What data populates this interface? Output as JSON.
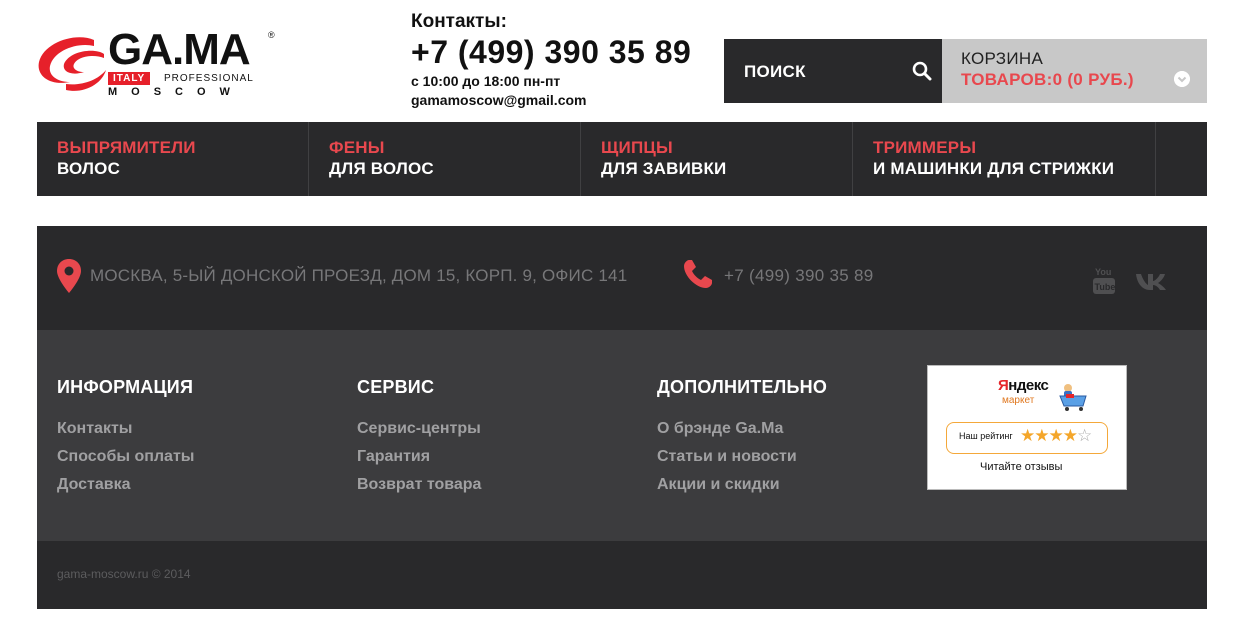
{
  "header": {
    "logo": {
      "word": "GA.MA",
      "reg": "®",
      "italy": "ITALY",
      "professional": "PROFESSIONAL",
      "moscow": "MOSCOW"
    },
    "contacts": {
      "title": "Контакты:",
      "phone": "+7 (499) 390 35 89",
      "hours": "с 10:00 до 18:00 пн-пт",
      "email": "gamamoscow@gmail.com"
    },
    "search": {
      "label": "ПОИСК"
    },
    "cart": {
      "title": "КОРЗИНА",
      "count": "ТОВАРОВ:0 (0 РУБ.)"
    }
  },
  "nav": {
    "items": [
      {
        "top": "ВЫПРЯМИТЕЛИ",
        "bottom": "ВОЛОС"
      },
      {
        "top": "ФЕНЫ",
        "bottom": "ДЛЯ ВОЛОС"
      },
      {
        "top": "ЩИПЦЫ",
        "bottom": "ДЛЯ ЗАВИВКИ"
      },
      {
        "top": "ТРИММЕРЫ",
        "bottom": "И МАШИНКИ ДЛЯ СТРИЖКИ"
      }
    ]
  },
  "strip": {
    "address": "МОСКВА, 5-ЫЙ ДОНСКОЙ ПРОЕЗД, ДОМ 15, КОРП. 9, ОФИС 141",
    "phone": "+7 (499) 390 35 89"
  },
  "footer": {
    "columns": [
      {
        "title": "ИНФОРМАЦИЯ",
        "links": [
          "Контакты",
          "Способы оплаты",
          "Доставка"
        ]
      },
      {
        "title": "СЕРВИС",
        "links": [
          "Сервис-центры",
          "Гарантия",
          "Возврат товара"
        ]
      },
      {
        "title": "ДОПОЛНИТЕЛЬНО",
        "links": [
          "О брэнде Ga.Ma",
          "Статьи и новости",
          "Акции и скидки"
        ]
      }
    ],
    "market": {
      "yandex_first": "Я",
      "yandex_rest": "ндекс",
      "sub": "маркет",
      "rating_label": "Наш рейтинг",
      "stars_filled": 4,
      "stars_total": 5,
      "reviews": "Читайте отзывы"
    }
  },
  "bottom": {
    "copyright": "gama-moscow.ru © 2014"
  },
  "colors": {
    "dark": "#29292b",
    "mid": "#3c3c3e",
    "accent": "#e8484e",
    "cart_bg": "#c8c8c8"
  }
}
